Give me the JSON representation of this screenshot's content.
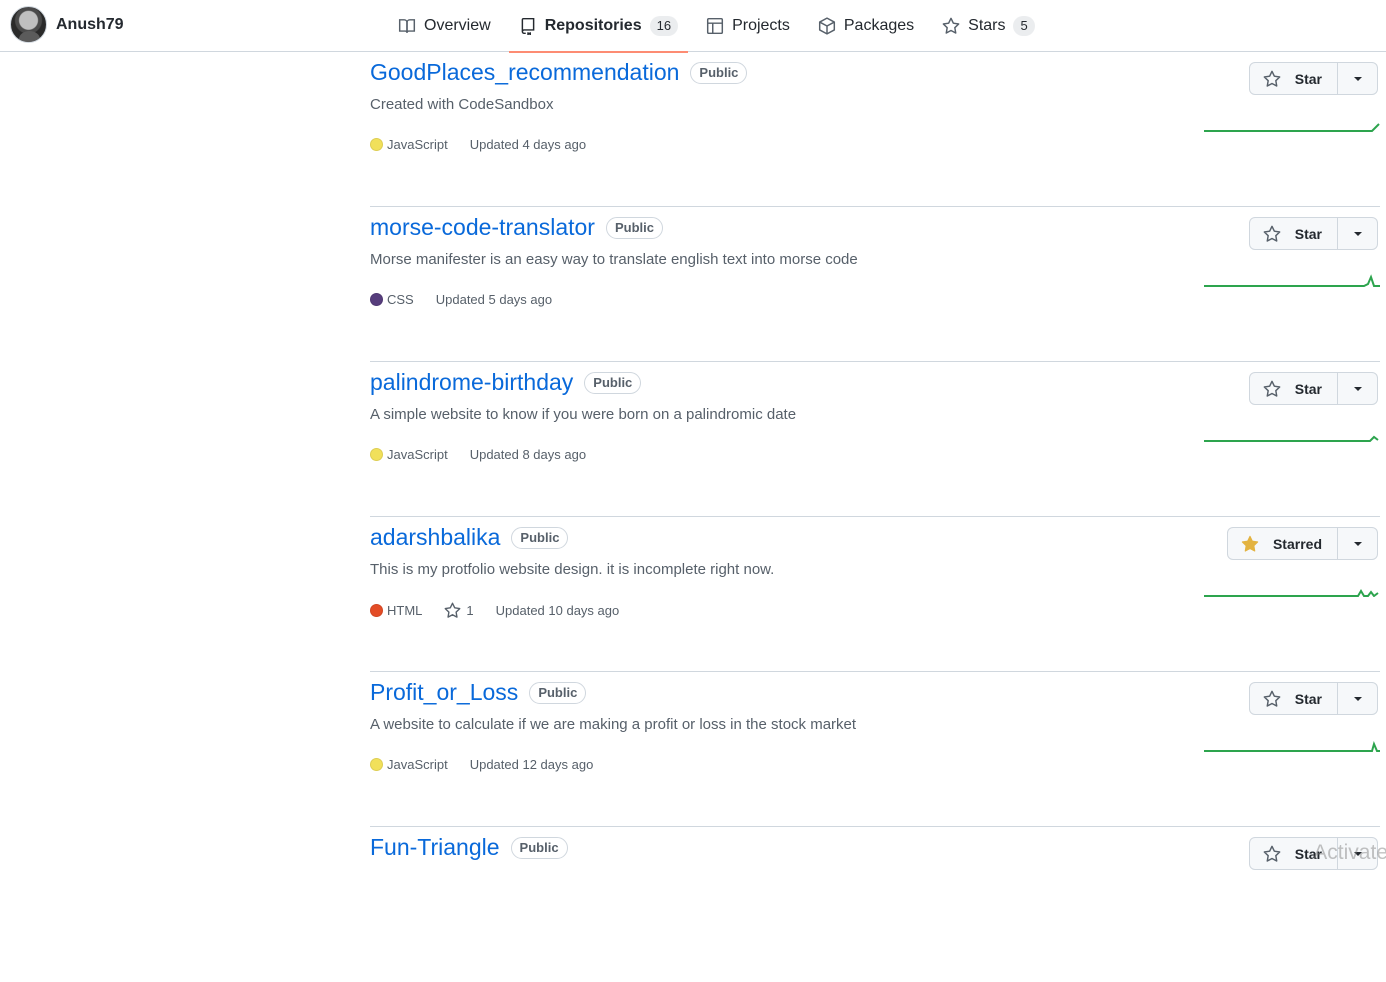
{
  "header": {
    "username": "Anush79",
    "tabs": [
      {
        "label": "Overview",
        "icon": "book-icon",
        "active": false
      },
      {
        "label": "Repositories",
        "icon": "repo-icon",
        "active": true,
        "count": "16"
      },
      {
        "label": "Projects",
        "icon": "table-icon",
        "active": false
      },
      {
        "label": "Packages",
        "icon": "package-icon",
        "active": false
      },
      {
        "label": "Stars",
        "icon": "star-icon",
        "active": false,
        "count": "5"
      }
    ]
  },
  "repos": [
    {
      "name": "GoodPlaces_recommendation",
      "visibility": "Public",
      "description": "Created with CodeSandbox",
      "language": "JavaScript",
      "language_color": "#f1e05a",
      "updated": "Updated 4 days ago",
      "star_label": "Star",
      "starred": false
    },
    {
      "name": "morse-code-translator",
      "visibility": "Public",
      "description": "Morse manifester is an easy way to translate english text into morse code",
      "language": "CSS",
      "language_color": "#563d7c",
      "updated": "Updated 5 days ago",
      "star_label": "Star",
      "starred": false
    },
    {
      "name": "palindrome-birthday",
      "visibility": "Public",
      "description": "A simple website to know if you were born on a palindromic date",
      "language": "JavaScript",
      "language_color": "#f1e05a",
      "updated": "Updated 8 days ago",
      "star_label": "Star",
      "starred": false
    },
    {
      "name": "adarshbalika",
      "visibility": "Public",
      "description": "This is my protfolio website design. it is incomplete right now.",
      "language": "HTML",
      "language_color": "#e34c26",
      "stars": "1",
      "updated": "Updated 10 days ago",
      "star_label": "Starred",
      "starred": true
    },
    {
      "name": "Profit_or_Loss",
      "visibility": "Public",
      "description": "A website to calculate if we are making a profit or loss in the stock market",
      "language": "JavaScript",
      "language_color": "#f1e05a",
      "updated": "Updated 12 days ago",
      "star_label": "Star",
      "starred": false
    },
    {
      "name": "Fun-Triangle",
      "visibility": "Public",
      "description": "",
      "language": "",
      "language_color": "#f1e05a",
      "updated": "",
      "star_label": "Star",
      "starred": false
    }
  ],
  "watermark": "Activate",
  "colors": {
    "link": "#0969da",
    "tab_underline": "#fd8c73",
    "sparkline": "#2da44e",
    "starred_icon": "#e3b341"
  }
}
